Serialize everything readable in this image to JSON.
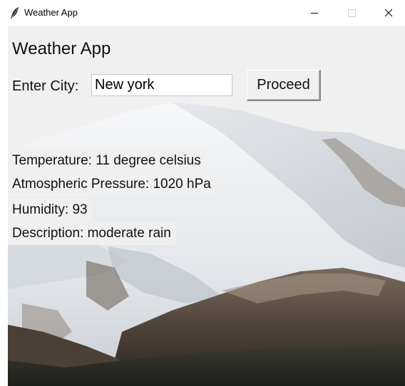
{
  "window": {
    "title": "Weather App",
    "icon": "feather-icon",
    "controls": {
      "minimize": "minimize-icon",
      "maximize": "maximize-icon",
      "close": "close-icon"
    }
  },
  "app": {
    "heading": "Weather App",
    "city_label": "Enter City:",
    "city_value": "New york",
    "proceed_label": "Proceed",
    "background": "snowy-mountain-image"
  },
  "results": {
    "temperature": "Temperature: 11 degree celsius",
    "pressure": "Atmospheric Pressure: 1020 hPa",
    "humidity": "Humidity: 93",
    "description": "Description: moderate rain"
  },
  "colors": {
    "window_bg": "#f0f0f0",
    "titlebar_bg": "#ffffff",
    "text": "#111111"
  }
}
